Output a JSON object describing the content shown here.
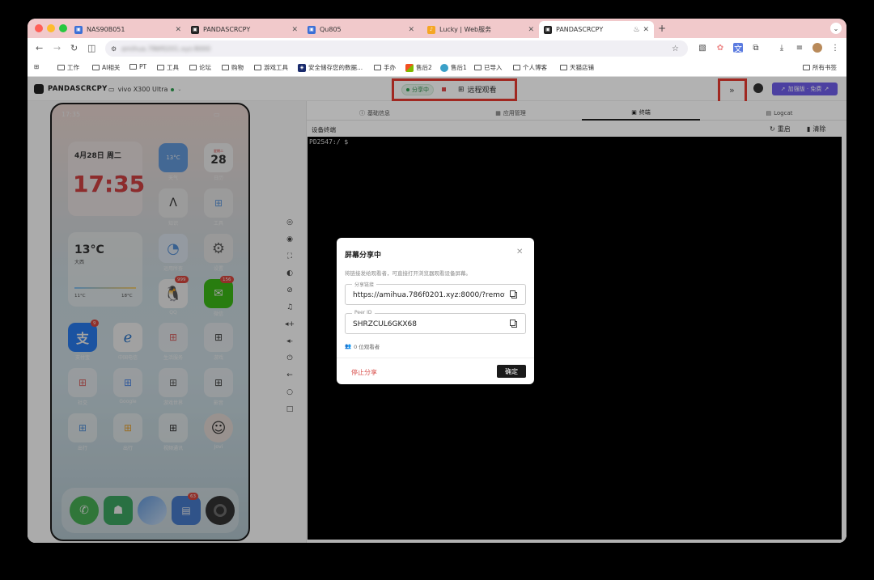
{
  "browser": {
    "tabs": [
      {
        "label": "NAS90B051",
        "fav_color": "#3b6fd6"
      },
      {
        "label": "PANDASCRCPY",
        "fav_color": "#222222"
      },
      {
        "label": "Qu805",
        "fav_color": "#3b6fd6"
      },
      {
        "label": "Lucky | Web服务",
        "fav_color": "#f5a623"
      },
      {
        "label": "PANDASCRCPY",
        "fav_color": "#222222"
      }
    ],
    "active_tab_index": 4,
    "new_tab": "+",
    "address": "amihua.786f0201.xyz:8000",
    "bookmarks": [
      "工作",
      "AI相关",
      "PT",
      "工具",
      "论坛",
      "购物",
      "游戏工具",
      "安全储存您的数据...",
      "手办",
      "售后2",
      "售后1",
      "已导入",
      "个人博客",
      "天猫店铺"
    ],
    "all_bookmarks": "所有书签"
  },
  "app": {
    "brand": "PANDASCRCPY",
    "device": "vivo X300 Ultra",
    "share_status": "分享中",
    "remote_view": "远程观看",
    "expand": "»",
    "pro_button": "加强版 · 免费"
  },
  "phone": {
    "time": "17:35",
    "date": "4月28日 周二",
    "big_clock": "17:35",
    "weather_temp": "13°C",
    "weather_city": "大西",
    "weather_low": "11°C",
    "weather_high": "18°C",
    "small_weather": "13°C",
    "cal_day": "28",
    "cal_week": "星期二",
    "apps_row1": [
      "天气",
      "日历"
    ],
    "apps_row2": [
      "知识",
      "工具"
    ],
    "apps_row3": [
      "运用所查",
      "设置"
    ],
    "apps_row4": [
      "QQ",
      "微信"
    ],
    "apps_row5": [
      "支付宝",
      "中国电信",
      "生活服务",
      "游戏"
    ],
    "apps_row6": [
      "社交",
      "Google",
      "游戏世界",
      "影音"
    ],
    "apps_row7": [
      "出行",
      "出行",
      "视频通讯",
      "Jovi"
    ],
    "badges": {
      "qq": "999",
      "wechat": "156",
      "alipay": "9",
      "dock": "63"
    }
  },
  "right": {
    "tabs": [
      "基础信息",
      "应用管理",
      "终端",
      "Logcat"
    ],
    "terminal_title": "设备终端",
    "restart": "重启",
    "clear": "清除",
    "prompt": "PD2547:/ $"
  },
  "modal": {
    "title": "屏幕分享中",
    "desc": "将链接发给观看者，可直接打开浏览器观看设备屏幕。",
    "link_label": "分享链接",
    "link_value": "https://amihua.786f0201.xyz:8000/?remote",
    "peer_label": "Peer ID",
    "peer_value": "SHRZCUL6GKX68",
    "viewers": "0 位观看者",
    "stop": "停止分享",
    "ok": "确定"
  }
}
